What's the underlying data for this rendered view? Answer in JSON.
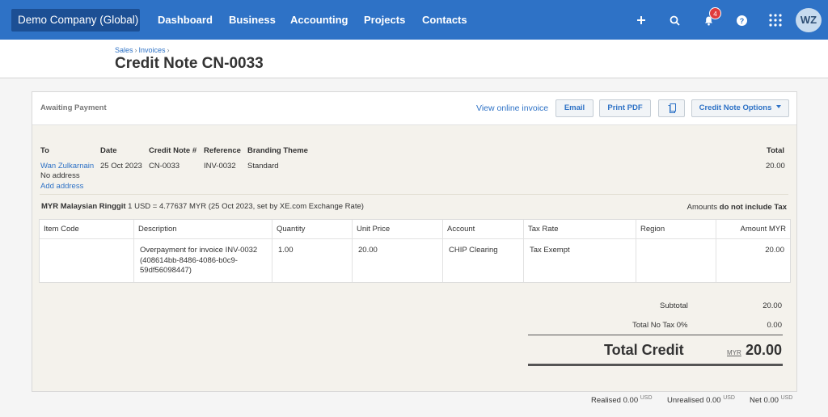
{
  "nav": {
    "org": "Demo Company (Global)",
    "links": [
      "Dashboard",
      "Business",
      "Accounting",
      "Projects",
      "Contacts"
    ],
    "notifications": "4",
    "avatar": "WZ",
    "icons": [
      "plus-icon",
      "search-icon",
      "bell-icon",
      "help-icon",
      "apps-grid-icon"
    ]
  },
  "header": {
    "breadcrumb": [
      "Sales",
      "Invoices"
    ],
    "title": "Credit Note CN-0033"
  },
  "toolbar": {
    "status": "Awaiting Payment",
    "view_online": "View online invoice",
    "email": "Email",
    "print_pdf": "Print PDF",
    "options": "Credit Note Options"
  },
  "details": {
    "labels": {
      "to": "To",
      "date": "Date",
      "number": "Credit Note #",
      "reference": "Reference",
      "theme": "Branding Theme",
      "total": "Total"
    },
    "to_name": "Wan Zulkarnain",
    "to_address": "No address",
    "add_address": "Add address",
    "date": "25 Oct 2023",
    "number": "CN-0033",
    "reference": "INV-0032",
    "theme": "Standard",
    "total": "20.00"
  },
  "currency": {
    "name": "MYR Malaysian Ringgit",
    "rate": "1 USD = 4.77637 MYR (25 Oct 2023, set by XE.com Exchange Rate)",
    "amounts_prefix": "Amounts",
    "amounts_tax": "do not include Tax"
  },
  "table": {
    "headers": [
      "Item Code",
      "Description",
      "Quantity",
      "Unit Price",
      "Account",
      "Tax Rate",
      "Region",
      "Amount MYR"
    ],
    "row": {
      "item_code": "",
      "description": "Overpayment for invoice INV-0032 (408614bb-8486-4086-b0c9-59df56098447)",
      "quantity": "1.00",
      "unit_price": "20.00",
      "account": "CHIP Clearing",
      "tax_rate": "Tax Exempt",
      "region": "",
      "amount": "20.00"
    }
  },
  "totals": {
    "subtotal_label": "Subtotal",
    "subtotal": "20.00",
    "tax_label": "Total No Tax 0%",
    "tax": "0.00",
    "credit_label": "Total Credit",
    "currency": "MYR",
    "credit": "20.00"
  },
  "footer": {
    "realised_label": "Realised",
    "realised": "0.00",
    "unrealised_label": "Unrealised",
    "unrealised": "0.00",
    "net_label": "Net",
    "net": "0.00",
    "currency": "USD"
  }
}
